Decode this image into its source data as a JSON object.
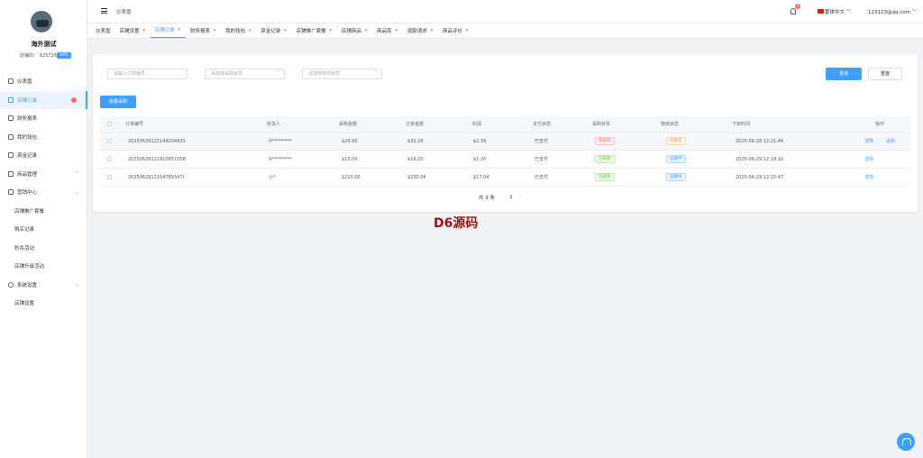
{
  "sidebar": {
    "shop_name": "海外测试",
    "shop_id": "店铺ID： 625726",
    "vip": "VIP1",
    "items": [
      {
        "label": "仪表盘"
      },
      {
        "label": "店铺订单"
      },
      {
        "label": "财务报表"
      },
      {
        "label": "我的钱包"
      },
      {
        "label": "资金记录"
      },
      {
        "label": "商品管理"
      },
      {
        "label": "营销中心"
      },
      {
        "label": "店铺推广套餐"
      },
      {
        "label": "购买记录"
      },
      {
        "label": "秒杀活动"
      },
      {
        "label": "店铺升级活动"
      },
      {
        "label": "系统设置"
      },
      {
        "label": "店铺设置"
      }
    ]
  },
  "header": {
    "breadcrumb": "仪表盘",
    "notif_count": "2",
    "language": "繁体中文",
    "user": "123123@qq.com"
  },
  "tabs": [
    {
      "label": "仪表盘"
    },
    {
      "label": "店铺设置"
    },
    {
      "label": "店铺订单"
    },
    {
      "label": "财务报表"
    },
    {
      "label": "我的钱包"
    },
    {
      "label": "资金记录"
    },
    {
      "label": "店铺推广套餐"
    },
    {
      "label": "店铺商品"
    },
    {
      "label": "商品库"
    },
    {
      "label": "退款请求"
    },
    {
      "label": "商品评价"
    }
  ],
  "filters": {
    "order_no_placeholder": "请输入订单编号",
    "purchase_status_placeholder": "请选择采购状态",
    "logistics_status_placeholder": "请选择物流状态",
    "search_label": "查询",
    "reset_label": "重置"
  },
  "bulk_label": "批量采购",
  "table": {
    "columns": [
      "订单编号",
      "收货人",
      "采购金额",
      "订单金额",
      "利润",
      "支付状态",
      "采购状态",
      "物流状态",
      "下单时间",
      "操作"
    ],
    "rows": [
      {
        "order_no": "2025062912214420483S",
        "receiver": "V*********",
        "purchase": "$29.90",
        "amount": "$32.29",
        "profit": "$2.39",
        "pay": "已支付",
        "purchase_status": "待采购",
        "logistics": "待发货",
        "time": "2025-06-29 12:21:44",
        "action1": "详情",
        "action2": "采购"
      },
      {
        "order_no": "2025062912191095725B",
        "receiver": "V*********",
        "purchase": "$15.00",
        "amount": "$16.20",
        "profit": "$1.20",
        "pay": "已支付",
        "purchase_status": "已采购",
        "logistics": "运输中",
        "time": "2025-06-29 12:19:10",
        "action1": "详情"
      },
      {
        "order_no": "2025062912154789347I",
        "receiver": "小*",
        "purchase": "$213.00",
        "amount": "$230.04",
        "profit": "$17.04",
        "pay": "已支付",
        "purchase_status": "已采购",
        "logistics": "运输中",
        "time": "2025-06-29 12:15:47",
        "action1": "详情"
      }
    ]
  },
  "pager": {
    "total": "共 3 条",
    "page": "1"
  },
  "watermark": "D6源码"
}
